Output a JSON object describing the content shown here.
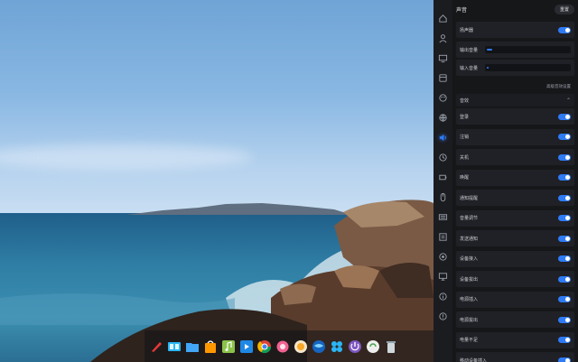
{
  "panel": {
    "title": "声音",
    "header_button": "重置",
    "speaker_label": "扬声器",
    "output_volume_label": "输出音量",
    "output_volume_level": 0.06,
    "input_volume_label": "输入音量",
    "input_volume_level": 0.02,
    "advanced_link": "高级音效设置",
    "section_title": "音效",
    "effects": [
      "登录",
      "注销",
      "关机",
      "唤醒",
      "通知提醒",
      "音量调节",
      "发送通知",
      "设备接入",
      "设备拔出",
      "电源插入",
      "电源拔出",
      "电量不足",
      "移动设备插入"
    ]
  },
  "nav": {
    "items": [
      "home-icon",
      "account-icon",
      "display-icon",
      "default-apps-icon",
      "personalization-icon",
      "network-icon",
      "sound-icon",
      "datetime-icon",
      "power-icon",
      "mouse-icon",
      "update-icon",
      "keyboard-icon",
      "printer-icon",
      "system-info-icon",
      "info-icon",
      "about-icon"
    ],
    "active": "sound-icon",
    "accent": "#2f7bf5"
  },
  "dock": {
    "apps": [
      "launcher-icon",
      "multitasking-icon",
      "file-manager-icon",
      "app-store-icon",
      "music-icon",
      "movie-icon",
      "browser-icon",
      "settings-icon",
      "deepin-store-icon",
      "web-icon",
      "control-center-icon",
      "shutdown-icon",
      "screenshot-icon",
      "trash-icon"
    ]
  },
  "colors": {
    "accent": "#2f7bf5",
    "panel_bg": "#161719",
    "row_bg": "#202126"
  }
}
